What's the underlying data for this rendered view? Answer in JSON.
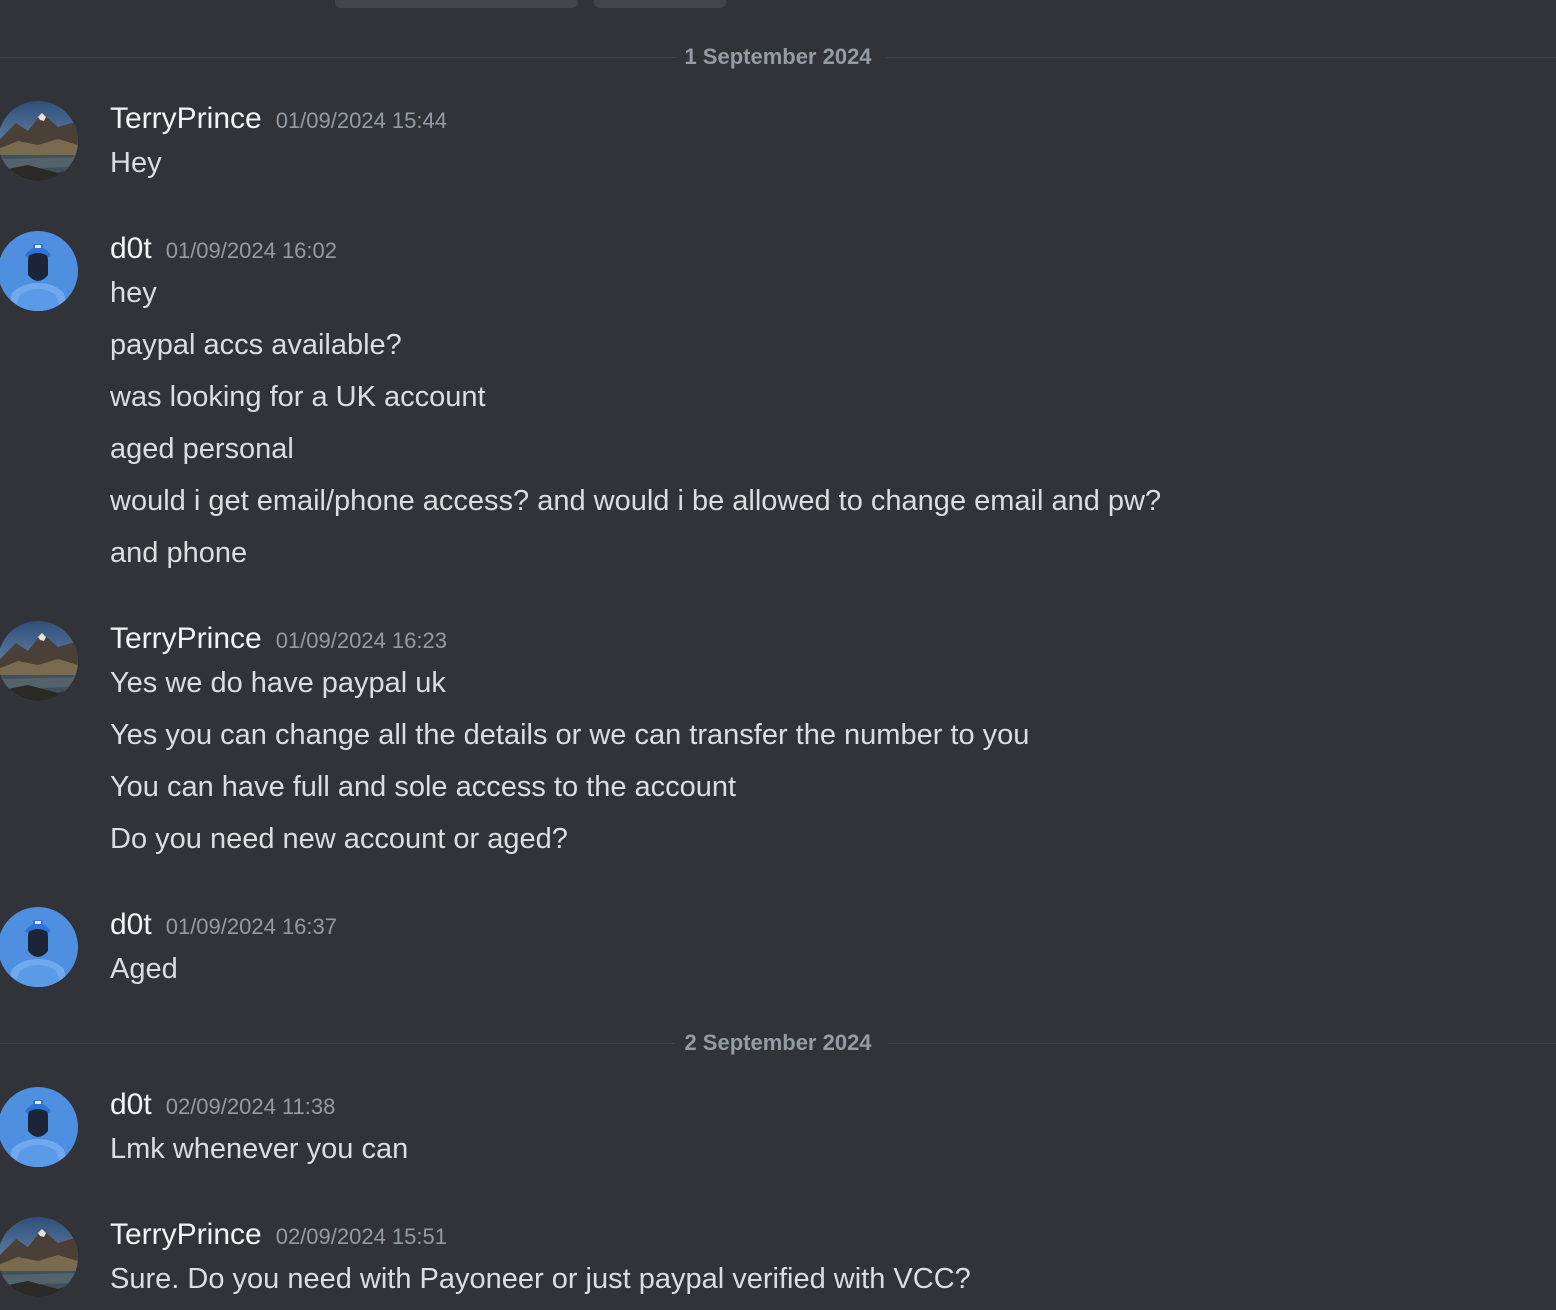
{
  "dividers": [
    {
      "label": "1 September 2024"
    },
    {
      "label": "2 September 2024"
    }
  ],
  "messages": [
    {
      "author": "TerryPrince",
      "avatar": "mountain-landscape-avatar",
      "timestamp": "01/09/2024 15:44",
      "lines": [
        "Hey"
      ]
    },
    {
      "author": "d0t",
      "avatar": "blue-hooded-figure-avatar",
      "timestamp": "01/09/2024 16:02",
      "lines": [
        "hey",
        "paypal accs available?",
        "was looking for a UK account",
        "aged personal",
        "would i get email/phone access? and would i be allowed to change email and pw?",
        "and phone"
      ]
    },
    {
      "author": "TerryPrince",
      "avatar": "mountain-landscape-avatar",
      "timestamp": "01/09/2024 16:23",
      "lines": [
        "Yes we do have paypal uk",
        "Yes you can change all the details or we can transfer the number to you",
        "You can have full and sole access to the account",
        "Do you need new account or aged?"
      ]
    },
    {
      "author": "d0t",
      "avatar": "blue-hooded-figure-avatar",
      "timestamp": "01/09/2024 16:37",
      "lines": [
        "Aged"
      ]
    },
    {
      "author": "d0t",
      "avatar": "blue-hooded-figure-avatar",
      "timestamp": "02/09/2024 11:38",
      "lines": [
        "Lmk whenever you can"
      ]
    },
    {
      "author": "TerryPrince",
      "avatar": "mountain-landscape-avatar",
      "timestamp": "02/09/2024 15:51",
      "lines": [
        "Sure. Do you need with Payoneer or just paypal verified with VCC?"
      ]
    }
  ],
  "colors": {
    "background": "#313338",
    "username": "#f2f3f5",
    "timestamp": "#949ba4",
    "message_text": "#dbdee1",
    "divider_line": "#3f4147"
  }
}
